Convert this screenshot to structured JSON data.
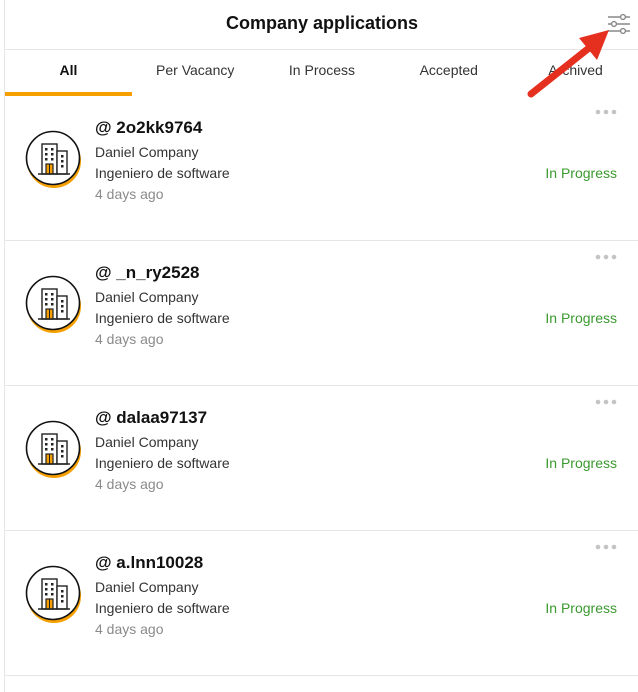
{
  "header": {
    "title": "Company applications",
    "filter_icon": "sliders-icon"
  },
  "tabs": [
    {
      "label": "All",
      "active": true
    },
    {
      "label": "Per Vacancy",
      "active": false
    },
    {
      "label": "In Process",
      "active": false
    },
    {
      "label": "Accepted",
      "active": false
    },
    {
      "label": "Archived",
      "active": false
    }
  ],
  "colors": {
    "accent": "#f5a000",
    "status_green": "#3a9a2e",
    "arrow_red": "#e53020"
  },
  "applications": [
    {
      "handle": "@ 2o2kk9764",
      "company": "Daniel Company",
      "position": "Ingeniero de software",
      "time": "4 days ago",
      "status": "In Progress"
    },
    {
      "handle": "@ _n_ry2528",
      "company": "Daniel Company",
      "position": "Ingeniero de software",
      "time": "4 days ago",
      "status": "In Progress"
    },
    {
      "handle": "@ dalaa97137",
      "company": "Daniel Company",
      "position": "Ingeniero de software",
      "time": "4 days ago",
      "status": "In Progress"
    },
    {
      "handle": "@ a.lnn10028",
      "company": "Daniel Company",
      "position": "Ingeniero de software",
      "time": "4 days ago",
      "status": "In Progress"
    }
  ]
}
